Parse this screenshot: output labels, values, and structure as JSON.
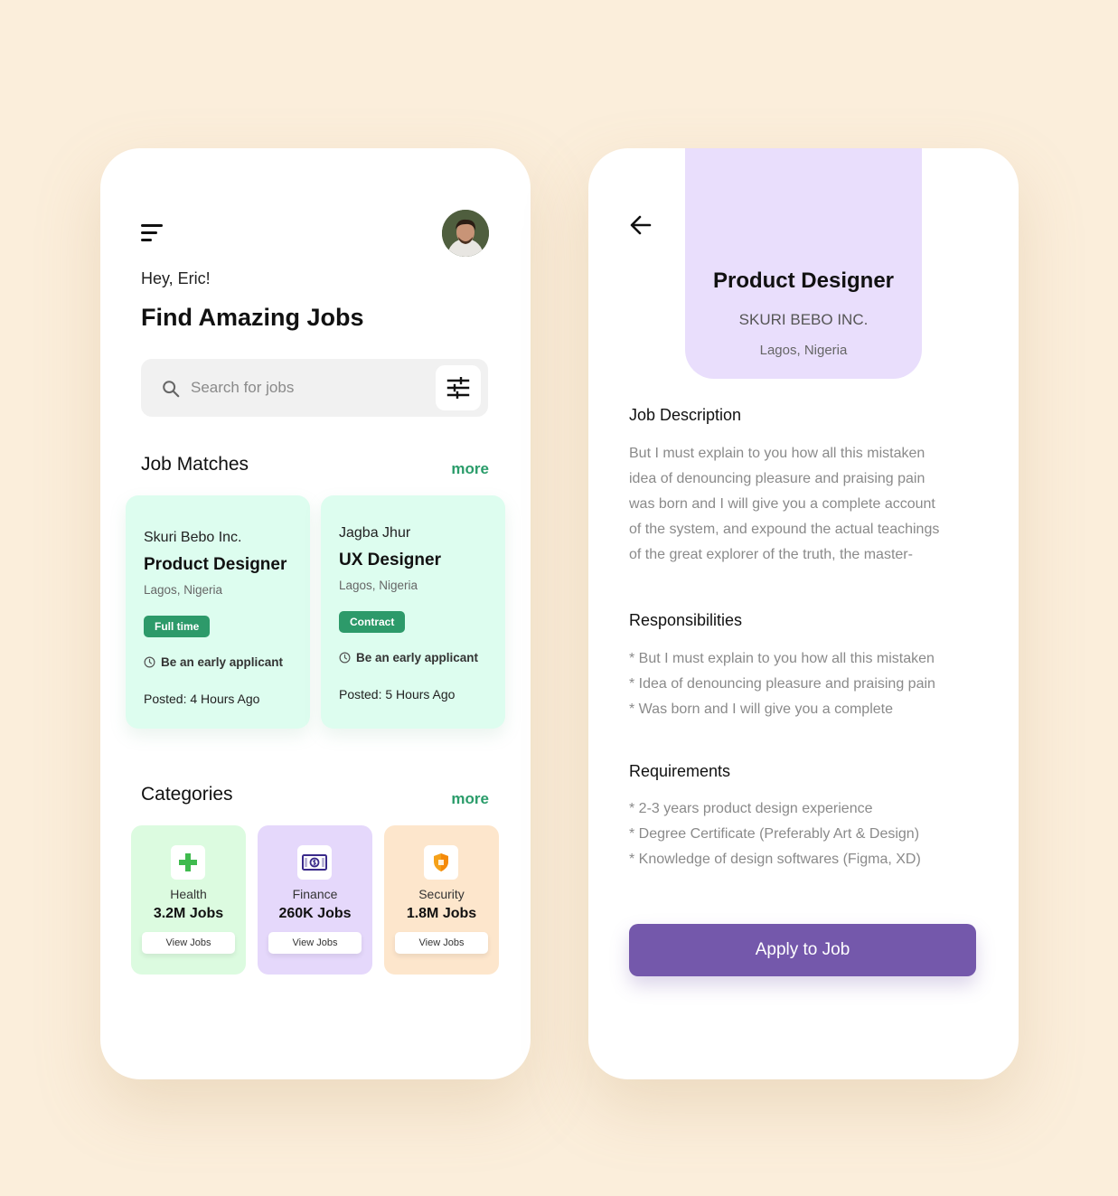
{
  "home": {
    "greeting": "Hey, Eric!",
    "headline": "Find Amazing Jobs",
    "search_placeholder": "Search for jobs",
    "job_matches": {
      "title": "Job Matches",
      "more": "more",
      "cards": [
        {
          "company": "Skuri Bebo Inc.",
          "role": "Product Designer",
          "location": "Lagos, Nigeria",
          "tag": "Full time",
          "early": "Be an early applicant",
          "posted": "Posted: 4 Hours Ago"
        },
        {
          "company": "Jagba Jhur",
          "role": "UX Designer",
          "location": "Lagos, Nigeria",
          "tag": "Contract",
          "early": "Be an early applicant",
          "posted": "Posted: 5 Hours Ago"
        }
      ]
    },
    "categories": {
      "title": "Categories",
      "more": "more",
      "items": [
        {
          "name": "Health",
          "count": "3.2M Jobs",
          "button": "View Jobs",
          "icon": "plus-icon",
          "bg": "#dcfbe0"
        },
        {
          "name": "Finance",
          "count": "260K Jobs",
          "button": "View Jobs",
          "icon": "money-icon",
          "bg": "#e5d8fb"
        },
        {
          "name": "Security",
          "count": "1.8M Jobs",
          "button": "View Jobs",
          "icon": "shield-icon",
          "bg": "#fde6cc"
        }
      ]
    }
  },
  "detail": {
    "title": "Product Designer",
    "company": "SKURI BEBO INC.",
    "location": "Lagos, Nigeria",
    "description_title": "Job Description",
    "description_lines": [
      "But I must explain to you how all this mistaken",
      "idea of denouncing pleasure and praising pain",
      "was born and I will give you a complete account",
      "of the system, and expound the actual teachings",
      "of the great explorer of the truth, the master-"
    ],
    "responsibilities_title": "Responsibilities",
    "responsibilities": [
      "*  But I must explain to you how all this mistaken",
      "*  Idea of denouncing pleasure and praising pain",
      "*  Was born and I will give you a complete"
    ],
    "requirements_title": "Requirements",
    "requirements": [
      "*  2-3 years product design experience",
      "* Degree Certificate (Preferably Art & Design)",
      "* Knowledge of design softwares (Figma, XD)"
    ],
    "apply_label": "Apply to Job"
  },
  "colors": {
    "background": "#fbeedb",
    "accent_green": "#2a9c6a",
    "card_green": "#ddfdef",
    "hero_purple": "#e9defc",
    "apply_purple": "#7458ab"
  }
}
